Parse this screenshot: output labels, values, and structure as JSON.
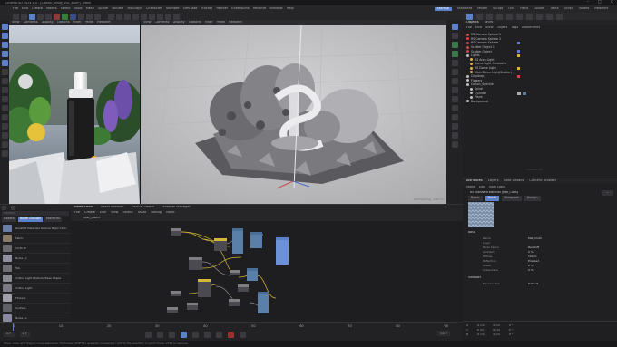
{
  "window": {
    "title": "Cinema 4D 2024.1.0 - [Cotton_candy_v01_sold*] - Main",
    "controls": [
      "–",
      "□",
      "✕"
    ]
  },
  "menubar": {
    "items": [
      "File",
      "Edit",
      "Create",
      "Modes",
      "Select",
      "Tools",
      "Mesh",
      "Spline",
      "Volume",
      "MoGraph",
      "Character",
      "Animate",
      "Simulate",
      "Tracker",
      "Render",
      "Extensions",
      "Redshift",
      "Window",
      "Help"
    ],
    "layout_tabs": [
      "Startup",
      "Standard",
      "Model",
      "Sculpt",
      "UVs",
      "Paint",
      "Groom",
      "Track",
      "Script",
      "Nodes",
      "Redshift"
    ],
    "active_layout": "Startup"
  },
  "left_viewport": {
    "menu": [
      "View",
      "Cameras",
      "Display",
      "Options",
      "Filter",
      "Panel",
      "Redshift"
    ],
    "label": "Default Camera"
  },
  "main_viewport": {
    "menu": [
      "View",
      "Cameras",
      "Display",
      "Options",
      "Filter",
      "Panel",
      "Redshift"
    ],
    "grid_label": "Grid Spacing : 100 cm"
  },
  "object_manager": {
    "tabs": [
      "Objects",
      "Takes"
    ],
    "menu": [
      "File",
      "Edit",
      "View",
      "Object",
      "Tags",
      "Bookmarks"
    ],
    "items": [
      {
        "name": "RS Camera Sphere 1",
        "color": "#d24646"
      },
      {
        "name": "RS Camera Sphere 2",
        "color": "#d24646"
      },
      {
        "name": "RS Camera Sphere",
        "color": "#d24646"
      },
      {
        "name": "Scatter Object 1",
        "color": "#d24646"
      },
      {
        "name": "Scatter Object",
        "color": "#d24646"
      },
      {
        "name": "Lights",
        "color": "#c0c0c0"
      },
      {
        "name": "RS Area Light",
        "color": "#e0b040"
      },
      {
        "name": "Dome Light Controller",
        "color": "#e0b040"
      },
      {
        "name": "RS Dome Light",
        "color": "#e0b040"
      },
      {
        "name": "Main Dome Light(Scatter)",
        "color": "#e0b040"
      },
      {
        "name": "Chipdrop",
        "color": "#c0c0c0"
      },
      {
        "name": "Flowers",
        "color": "#c0c0c0"
      },
      {
        "name": "Cotton_Speckle",
        "color": "#c0c0c0"
      },
      {
        "name": "Spiral",
        "color": "#c0c0c0"
      },
      {
        "name": "Cylinder",
        "color": "#c0c0c0"
      },
      {
        "name": "Plane",
        "color": "#c0c0c0"
      },
      {
        "name": "Background",
        "color": "#c0c0c0"
      }
    ]
  },
  "watermark": "Cinema 4D",
  "attributes": {
    "tabs": [
      "Attributes",
      "Layers",
      "Take Details",
      "Content Browser"
    ],
    "menu": [
      "Mode",
      "Edit",
      "User Data"
    ],
    "material_name": "RS Standard Material [Mat_Cloth]",
    "mode_tabs": [
      "Basic",
      "Node",
      "Viewport",
      "Assign"
    ],
    "active_mode": "Node",
    "section": "Basic",
    "rows": [
      {
        "label": "Name",
        "value": "Mat_Cloth"
      },
      {
        "label": "Layer",
        "value": ""
      },
      {
        "label": "Node Space",
        "value": "Redshift"
      },
      {
        "label": "Ambient",
        "value": "0 %"
      },
      {
        "label": "Diffuse",
        "value": "100 %"
      },
      {
        "label": "Reflection",
        "value": "Enabled"
      },
      {
        "label": "Sheen",
        "value": "0 %"
      },
      {
        "label": "Subsurface",
        "value": "0 %"
      }
    ],
    "subsection": "Viewport",
    "sub_rows": [
      {
        "label": "Preview Size",
        "value": "Default"
      }
    ]
  },
  "coordinates": {
    "rows": [
      {
        "axis": "X",
        "pos": "0 cm",
        "size": "0 cm",
        "rot": "0 °"
      },
      {
        "axis": "Y",
        "pos": "0 cm",
        "size": "0 cm",
        "rot": "0 °"
      },
      {
        "axis": "Z",
        "pos": "0 cm",
        "size": "0 cm",
        "rot": "0 °"
      }
    ]
  },
  "node_editor": {
    "tabs": [
      "Node Editor",
      "Asset Browser",
      "Picture Viewer",
      "Material Manager"
    ],
    "menu": [
      "File",
      "Create",
      "Edit",
      "View",
      "Select",
      "Asset",
      "Debug",
      "Node"
    ],
    "breadcrumb": "Mat_Cloth",
    "nodes": [
      "Texture",
      "Texture",
      "Color Correct",
      "Ramp",
      "Bump",
      "Standard Material",
      "Output",
      "Texture",
      "Mix",
      "Displacement"
    ]
  },
  "asset_panel": {
    "tabs": [
      "Assets",
      "Node Groups",
      "Material"
    ],
    "search_placeholder": "Search",
    "layers": [
      {
        "name": "Redshift Materials Texture Maps Cloth",
        "color": "#6b7ea8"
      },
      {
        "name": "Fabric",
        "color": "#8a7a6a"
      },
      {
        "name": "Cloth Hi",
        "color": "#6a6a70"
      },
      {
        "name": "Noise Lo",
        "color": "#9090a0"
      },
      {
        "name": "Mix",
        "color": "#707078"
      },
      {
        "name": "Cotton Light Material Base Shape",
        "color": "#8a8a94"
      },
      {
        "name": "Cotton Light",
        "color": "#7a7a86"
      },
      {
        "name": "Flowers",
        "color": "#a0a0aa"
      },
      {
        "name": "Surface",
        "color": "#606068"
      },
      {
        "name": "Noise Lo",
        "color": "#8888a0"
      },
      {
        "name": "Ripple Lo Neutral",
        "color": "#7a8aa4"
      }
    ]
  },
  "timeline": {
    "current_frame": "0 F",
    "start": "0 F",
    "end": "90 F",
    "ticks": [
      "0",
      "10",
      "20",
      "30",
      "40",
      "50",
      "60",
      "70",
      "80",
      "90"
    ],
    "buttons": [
      "first-frame",
      "prev-key",
      "prev-frame",
      "play",
      "next-frame",
      "next-key",
      "last-frame",
      "record",
      "auto-key"
    ]
  },
  "status": {
    "text": "Move: Click and drag to move elements. Hold down SHIFT to quantize movement / add to the selection in point mode, CTRL to remove."
  },
  "colors": {
    "accent": "#5b82c9",
    "bg": "#1b1b1d",
    "panel": "#262629"
  }
}
